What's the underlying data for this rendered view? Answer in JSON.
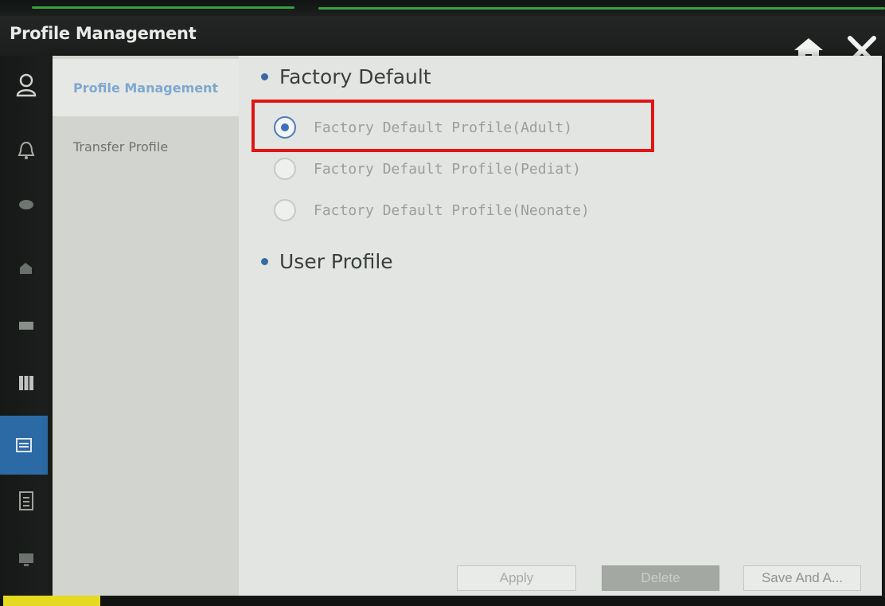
{
  "window": {
    "title": "Profile Management",
    "home_icon": "home-icon",
    "close_icon": "close-icon"
  },
  "sidebar_icons": [
    {
      "name": "patient-icon",
      "active": false
    },
    {
      "name": "alarm-bell-icon",
      "active": false
    },
    {
      "name": "parameters-icon",
      "active": false
    },
    {
      "name": "device-icon",
      "active": false
    },
    {
      "name": "display-icon",
      "active": false
    },
    {
      "name": "layout-icon",
      "active": false
    },
    {
      "name": "profile-icon",
      "active": true
    },
    {
      "name": "report-icon",
      "active": false
    },
    {
      "name": "monitor-icon",
      "active": false
    }
  ],
  "subnav": {
    "items": [
      {
        "label": "Profile Management",
        "selected": true
      },
      {
        "label": "Transfer Profile",
        "selected": false
      }
    ]
  },
  "factory_default": {
    "heading": "Factory Default",
    "options": [
      {
        "label": "Factory Default Profile(Adult)",
        "checked": true
      },
      {
        "label": "Factory Default Profile(Pediat)",
        "checked": false
      },
      {
        "label": "Factory Default Profile(Neonate)",
        "checked": false
      }
    ]
  },
  "user_profile": {
    "heading": "User Profile"
  },
  "buttons": {
    "apply": "Apply",
    "delete": "Delete",
    "save_and_apply": "Save And A..."
  },
  "colors": {
    "accent": "#3b72bd",
    "active_sidebar": "#2c6aa5",
    "highlight": "#e01616"
  }
}
